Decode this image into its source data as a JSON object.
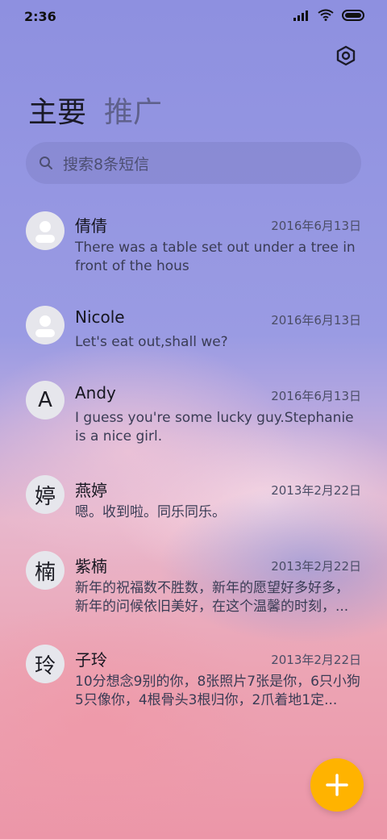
{
  "status_bar": {
    "time": "2:36",
    "icons": [
      "signal-icon",
      "wifi-icon",
      "battery-icon"
    ]
  },
  "header": {
    "settings_icon": "gear-icon"
  },
  "tabs": [
    {
      "label": "主要",
      "active": true
    },
    {
      "label": "推广",
      "active": false
    }
  ],
  "search": {
    "placeholder": "搜索8条短信",
    "icon": "search-icon"
  },
  "conversations": [
    {
      "avatar_text": "",
      "avatar_icon": "person-icon",
      "name": "倩倩",
      "date": "2016年6月13日",
      "preview": "There was a table set out under a tree in front of the hous"
    },
    {
      "avatar_text": "",
      "avatar_icon": "person-icon",
      "name": "Nicole",
      "date": "2016年6月13日",
      "preview": "Let's eat out,shall we?"
    },
    {
      "avatar_text": "A",
      "name": "Andy",
      "date": "2016年6月13日",
      "preview": "I guess you're some lucky guy.Stephanie is a nice girl."
    },
    {
      "avatar_text": "婷",
      "name": "燕婷",
      "date": "2013年2月22日",
      "preview": "嗯。收到啦。同乐同乐。"
    },
    {
      "avatar_text": "楠",
      "name": "紫楠",
      "date": "2013年2月22日",
      "preview": "新年的祝福数不胜数，新年的愿望好多好多，新年的问候依旧美好，在这个温馨的时刻，..."
    },
    {
      "avatar_text": "玲",
      "name": "子玲",
      "date": "2013年2月22日",
      "preview": "10分想念9别的你，8张照片7张是你，6只小狗5只像你，4根骨头3根归你，2爪着地1定..."
    }
  ],
  "fab": {
    "icon": "plus-icon",
    "color": "#ffb300"
  },
  "colors": {
    "accent": "#ffb300"
  }
}
